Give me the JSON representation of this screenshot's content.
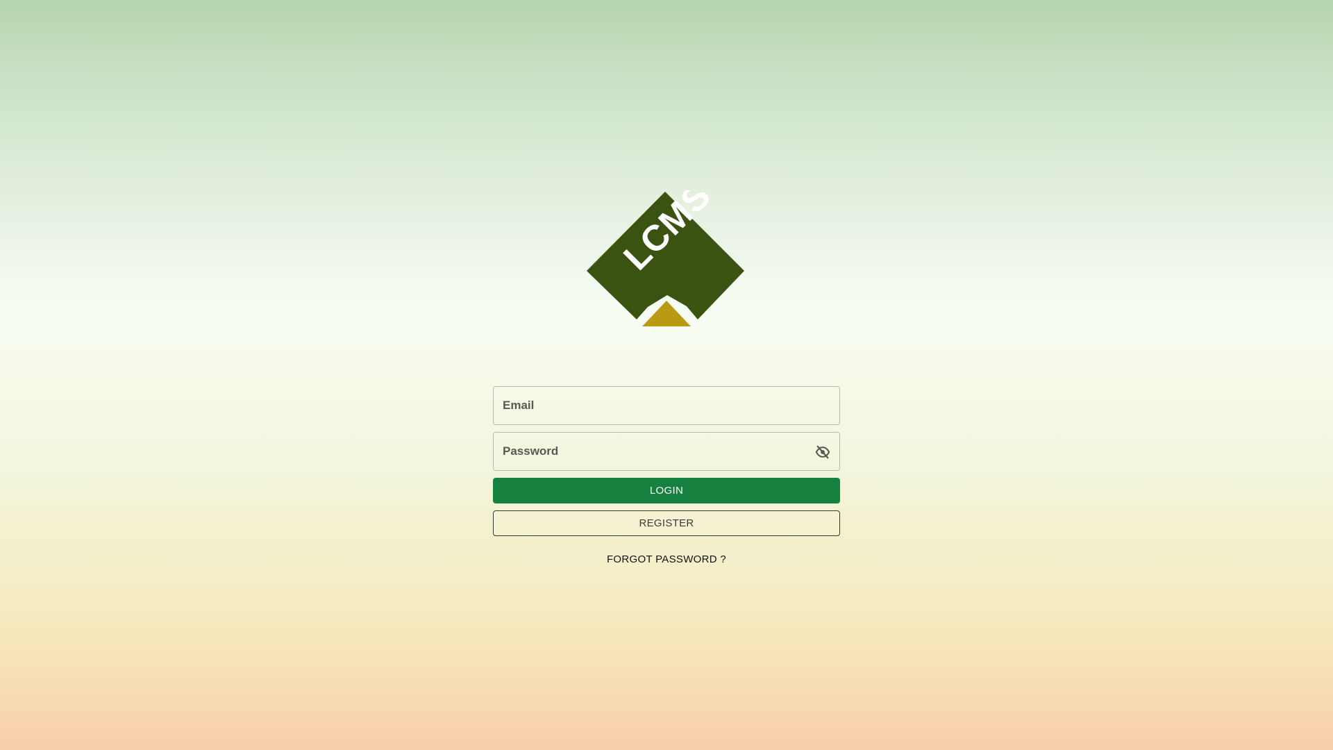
{
  "logo": {
    "text": "LCMS",
    "colors": {
      "diamond": "#3b5310",
      "roof": "#b99a12",
      "lettering": "#ffffff"
    }
  },
  "form": {
    "email": {
      "placeholder": "Email",
      "value": ""
    },
    "password": {
      "placeholder": "Password",
      "value": "",
      "toggle_icon": "eye-off-icon"
    },
    "login_label": "LOGIN",
    "register_label": "REGISTER",
    "forgot_label": "FORGOT PASSWORD ?"
  },
  "colors": {
    "login_button": "#16803f",
    "register_border": "#2f3a2f"
  }
}
